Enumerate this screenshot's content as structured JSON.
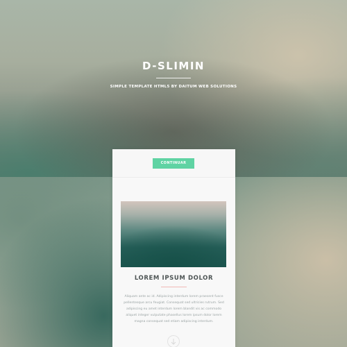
{
  "hero": {
    "title": "D-SLIMIN",
    "subtitle": "SIMPLE TEMPLATE HTML5 BY DAITUM WEB SOLUTIONS"
  },
  "card": {
    "button_label": "CONTINUAR",
    "title": "LOREM IPSUM DOLOR",
    "body_text": "Aliquam ante ac id. Adipiscing interdum lorem praesent fusce pellentesque arcu feugiat. Consequat sed ultricies rutrum. Sed adipiscing eu amet interdum lorem blandit vis ac commodo aliquet integer vulputate phasellus lorem ipsum dolor lorem magna consequat sed etiam adipiscing interdum.",
    "scroll_icon": "arrow-down-icon"
  },
  "colors": {
    "accent_button": "#5fd3a3",
    "title_text": "#4d5454",
    "divider_pink": "#f1b9b6"
  }
}
